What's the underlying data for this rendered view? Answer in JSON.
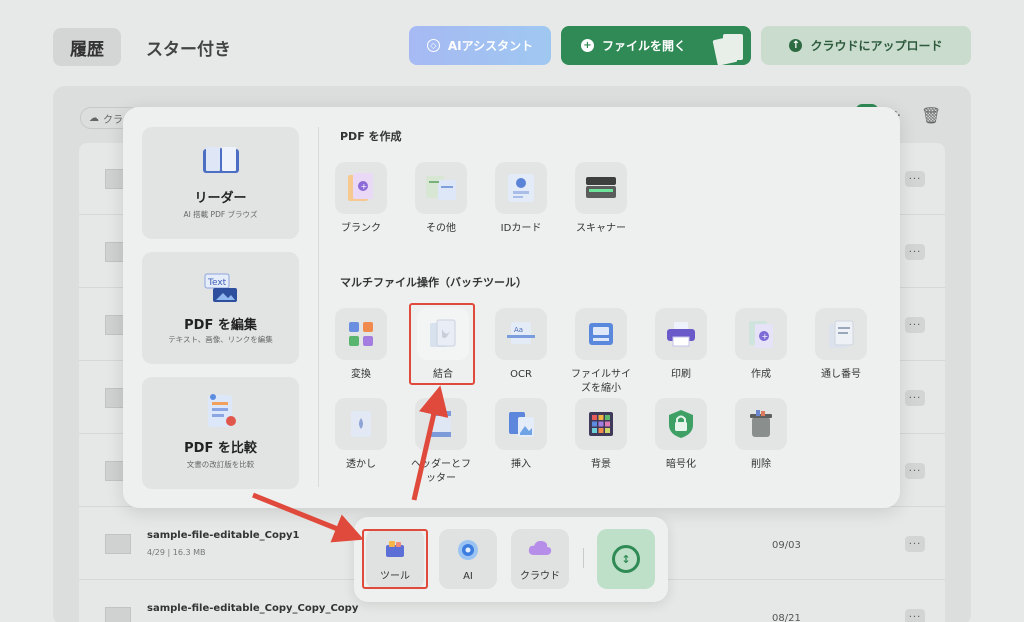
{
  "header": {
    "tabs": [
      {
        "label": "履歴"
      },
      {
        "label": "スター付き"
      }
    ],
    "ai_label": "AIアシスタント",
    "open_label": "ファイルを開く",
    "upload_label": "クラウドにアップロード"
  },
  "list": {
    "chip_label": "クラ",
    "rows": [
      {
        "name": "sample-file-editable_Copy1",
        "meta": "4/29 | 16.3 MB",
        "date": "09/03"
      },
      {
        "name": "sample-file-editable_Copy_Copy_Copy",
        "meta": "",
        "date": "08/21"
      }
    ],
    "more_label": "···"
  },
  "popup": {
    "left_cards": [
      {
        "title": "リーダー",
        "sub": "AI 搭載 PDF ブラウズ"
      },
      {
        "title": "PDF を編集",
        "sub": "テキスト、画像、リンクを編集"
      },
      {
        "title": "PDF を比較",
        "sub": "文書の改訂版を比較"
      }
    ],
    "create_section": {
      "title": "PDF を作成",
      "items": [
        {
          "label": "ブランク"
        },
        {
          "label": "その他"
        },
        {
          "label": "IDカード"
        },
        {
          "label": "スキャナー"
        }
      ]
    },
    "batch_section": {
      "title": "マルチファイル操作（バッチツール）",
      "row1": [
        {
          "label": "変換"
        },
        {
          "label": "結合"
        },
        {
          "label": "OCR"
        },
        {
          "label": "ファイルサイズを縮小"
        },
        {
          "label": "印刷"
        },
        {
          "label": "作成"
        },
        {
          "label": "通し番号"
        }
      ],
      "row2": [
        {
          "label": "透かし"
        },
        {
          "label": "ヘッダーとフッター"
        },
        {
          "label": "挿入"
        },
        {
          "label": "背景"
        },
        {
          "label": "暗号化"
        },
        {
          "label": "削除"
        }
      ]
    }
  },
  "dock": {
    "items": [
      {
        "label": "ツール"
      },
      {
        "label": "AI"
      },
      {
        "label": "クラウド"
      }
    ]
  },
  "colors": {
    "accent": "#2f8a55",
    "highlight": "#e04a3c",
    "ai_gradient": "#a6b9f3"
  }
}
